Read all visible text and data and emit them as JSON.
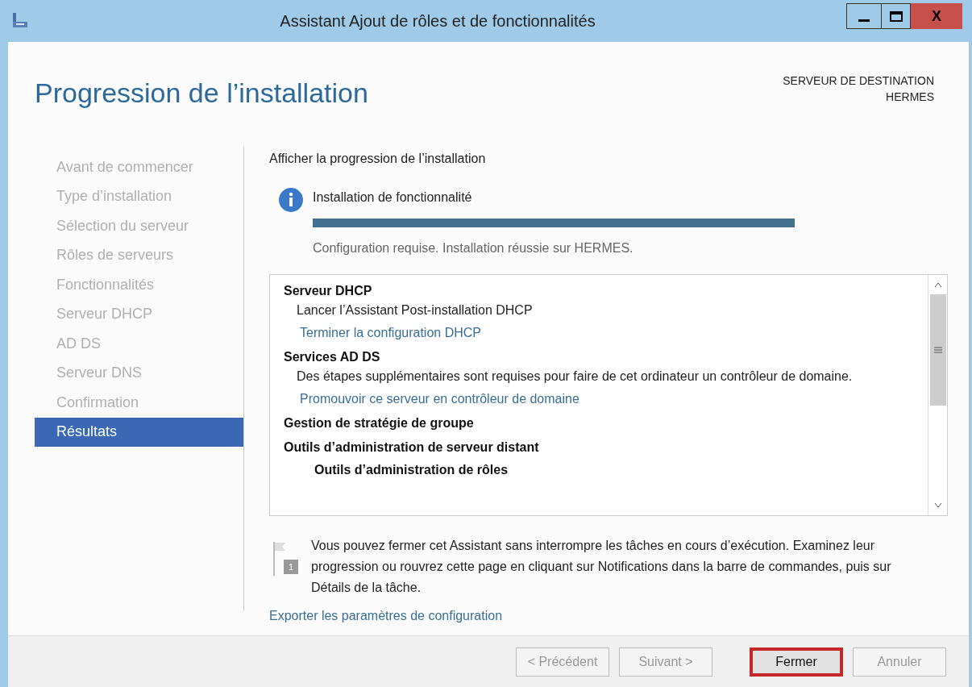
{
  "window": {
    "title": "Assistant Ajout de rôles et de fonctionnalités",
    "close_glyph": "X"
  },
  "page_title": "Progression de l’installation",
  "destination": {
    "label": "SERVEUR DE DESTINATION",
    "server": "HERMES"
  },
  "sidebar": {
    "items": [
      {
        "label": "Avant de commencer",
        "selected": false
      },
      {
        "label": "Type d’installation",
        "selected": false
      },
      {
        "label": "Sélection du serveur",
        "selected": false
      },
      {
        "label": "Rôles de serveurs",
        "selected": false
      },
      {
        "label": "Fonctionnalités",
        "selected": false
      },
      {
        "label": "Serveur DHCP",
        "selected": false
      },
      {
        "label": "AD DS",
        "selected": false
      },
      {
        "label": "Serveur DNS",
        "selected": false
      },
      {
        "label": "Confirmation",
        "selected": false
      },
      {
        "label": "Résultats",
        "selected": true
      }
    ]
  },
  "section_label": "Afficher la progression de l’installation",
  "progress": {
    "title": "Installation de fonctionnalité",
    "level": 1,
    "status": "Configuration requise. Installation réussie sur HERMES."
  },
  "results": [
    {
      "title": "Serveur DHCP",
      "children": [
        {
          "kind": "text",
          "text": "Lancer l’Assistant Post-installation DHCP"
        },
        {
          "kind": "link",
          "text": "Terminer la configuration DHCP"
        }
      ]
    },
    {
      "title": "Services AD DS",
      "children": [
        {
          "kind": "text",
          "text": "Des étapes supplémentaires sont requises pour faire de cet ordinateur un contrôleur de domaine."
        },
        {
          "kind": "link",
          "text": "Promouvoir ce serveur en contrôleur de domaine"
        }
      ]
    },
    {
      "title": "Gestion de stratégie de groupe"
    },
    {
      "title": "Outils d’administration de serveur distant",
      "children": [
        {
          "kind": "heading",
          "text": "Outils d’administration de rôles"
        }
      ]
    }
  ],
  "notice": {
    "badge": "1",
    "text": "Vous pouvez fermer cet Assistant sans interrompre les tâches en cours d’exécution. Examinez leur progression ou rouvrez cette page en cliquant sur Notifications dans la barre de commandes, puis sur Détails de la tâche."
  },
  "export_link": "Exporter les paramètres de configuration",
  "buttons": [
    {
      "label": "< Précédent",
      "disabled": true,
      "highlighted": false
    },
    {
      "label": "Suivant >",
      "disabled": true,
      "highlighted": false
    },
    {
      "label": "Fermer",
      "disabled": false,
      "highlighted": true
    },
    {
      "label": "Annuler",
      "disabled": true,
      "highlighted": false
    }
  ]
}
